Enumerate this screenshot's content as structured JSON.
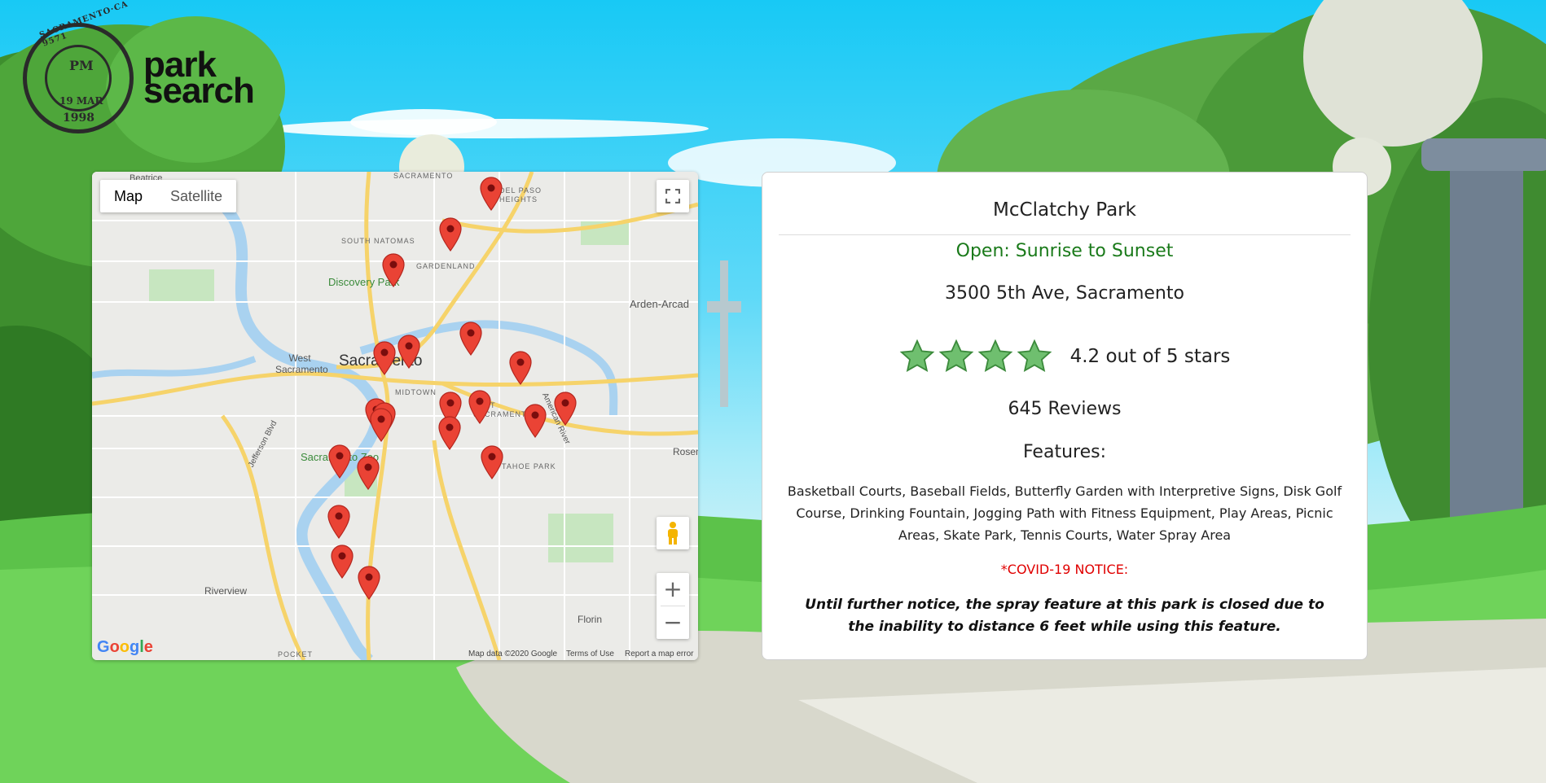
{
  "logo": {
    "stamp_top": "SACRAMENTO·CA 9571",
    "stamp_pm": "PM",
    "stamp_date": "19 MAR",
    "stamp_year": "1998",
    "brand_line1": "park",
    "brand_line2": "search"
  },
  "map": {
    "type_buttons": [
      "Map",
      "Satellite"
    ],
    "active_type": "Map",
    "labels": {
      "sacramento": "Sacramento",
      "west_sacramento": "West Sacramento",
      "discovery_park": "Discovery Park",
      "sacramento_zoo": "Sacramento Zoo",
      "arden_arcade": "Arden-Arcad",
      "riverview": "Riverview",
      "florin": "Florin",
      "rosemont": "Rosem",
      "beatrice": "Beatrice",
      "south_natomas": "SOUTH NATOMAS",
      "gardenland": "GARDENLAND",
      "del_paso_heights": "DEL PASO HEIGHTS",
      "midtown": "MIDTOWN",
      "east_sacramento": "EAST SACRAMENTO",
      "tahoe_park": "TAHOE PARK",
      "pocket": "POCKET",
      "american_river": "American River",
      "jefferson_blvd": "Jefferson Blvd",
      "sacramento_top": "SACRAMENTO"
    },
    "attribution": {
      "data": "Map data ©2020 Google",
      "terms": "Terms of Use",
      "report": "Report a map error"
    },
    "google_logo": "Google",
    "controls": {
      "fullscreen_icon": "fullscreen-icon",
      "pegman_icon": "pegman-icon",
      "zoom_in": "+",
      "zoom_out": "−"
    },
    "marker_count": 24
  },
  "park": {
    "name": "McClatchy Park",
    "hours": "Open: Sunrise to Sunset",
    "address": "3500 5th Ave, Sacramento",
    "rating_value": 4.2,
    "rating_text": "4.2 out of 5 stars",
    "stars_shown": 4,
    "star_color": "#6fbf6f",
    "reviews": "645 Reviews",
    "features_heading": "Features:",
    "features": "Basketball Courts, Baseball Fields, Butterfly Garden with Interpretive Signs, Disk Golf Course, Drinking Fountain, Jogging Path with Fitness Equipment, Play Areas, Picnic Areas, Skate Park, Tennis Courts, Water Spray Area",
    "notice_label": "*COVID-19 NOTICE:",
    "notice_color": "#e00000",
    "notice_message": "Until further notice, the spray feature at this park is closed due to the inability to distance 6 feet while using this feature.",
    "hours_color": "#1a7a1a"
  }
}
